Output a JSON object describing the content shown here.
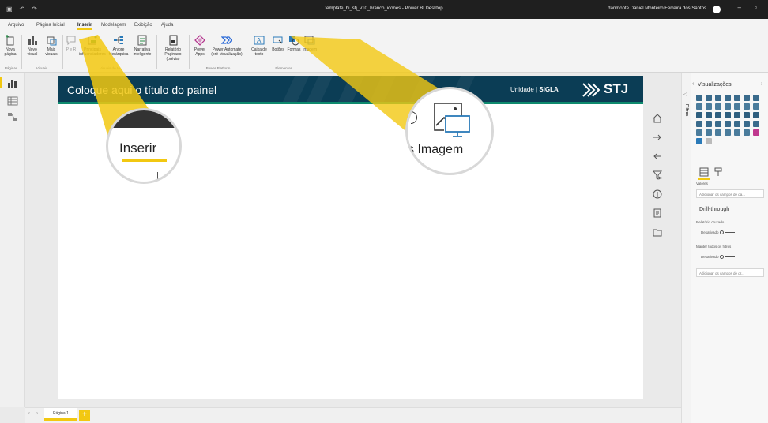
{
  "window": {
    "title": "template_bi_stj_v10_branco_icones - Power BI Desktop",
    "user": "danmonte Daniel Monteiro Ferreira dos Santos"
  },
  "ribbon": {
    "tabs": [
      "Arquivo",
      "Página Inicial",
      "Inserir",
      "Modelagem",
      "Exibição",
      "Ajuda"
    ],
    "active_tab": "Inserir",
    "buttons": {
      "nova_pagina": "Nova página",
      "novo_visual": "Novo visual",
      "mais_visuais": "Mais visuais",
      "pn": "P e R",
      "principais": "Principais influenciadores",
      "arvore": "Árvore hierárquica",
      "narrativa": "Narrativa inteligente",
      "relatorio": "Relatório Paginado (prévia)",
      "power_apps": "Power Apps",
      "power_automate": "Power Automate (pré-visualização)",
      "caixa": "Caixa de texto",
      "botoes": "Botões",
      "formas": "Formas",
      "imagem": "Imagem"
    },
    "groups": {
      "paginas": "Páginas",
      "visuais": "Visuais",
      "visuais_ia": "Visuais de IA",
      "power_platform": "Power Platform",
      "elementos": "Elementos"
    }
  },
  "canvas": {
    "title": "Coloque aqui o título do painel",
    "unit_label": "Unidade |",
    "unit_sigla": "SIGLA",
    "logo": "STJ"
  },
  "magnifiers": {
    "left_label": "Inserir",
    "right_label": "s Imagem"
  },
  "page_tabs": {
    "page1": "Página 1",
    "add": "+"
  },
  "panes": {
    "filters": "Filtros",
    "visualizations": "Visualizações",
    "valores": "Valores",
    "add_fields_1": "Adicionar os campos de da...",
    "drillthrough": "Drill-through",
    "relatorio_cruzado": "Relatório cruzado",
    "desativado_1": "Desativado",
    "manter_filtros": "Manter todos os filtros",
    "desativado_2": "Desativado",
    "add_fields_2": "Adicionar os campos de dr..."
  },
  "colors": {
    "accent": "#f2c811",
    "banner": "#0b3d55",
    "banner_border": "#0e8a6e",
    "titlebar": "#1f1f1f"
  }
}
